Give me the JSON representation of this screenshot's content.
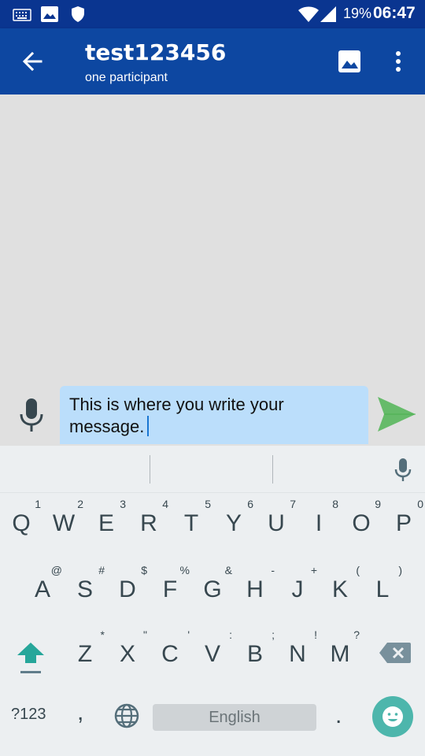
{
  "status_bar": {
    "battery_text": "19%",
    "time": "06:47",
    "icons": [
      "keyboard-icon",
      "image-icon",
      "shield-icon",
      "wifi-icon",
      "signal-icon",
      "battery-icon"
    ]
  },
  "app_bar": {
    "title": "test123456",
    "subtitle": "one participant",
    "icons": [
      "arrow-back-icon",
      "image-icon",
      "more-vert-icon"
    ]
  },
  "compose": {
    "text": "This is where you write your message.",
    "colors": {
      "field": "#bbdefb",
      "send": "#66bb6a",
      "caret": "#1976d2"
    }
  },
  "keyboard": {
    "row1": [
      {
        "key": "Q",
        "hint": "1"
      },
      {
        "key": "W",
        "hint": "2"
      },
      {
        "key": "E",
        "hint": "3"
      },
      {
        "key": "R",
        "hint": "4"
      },
      {
        "key": "T",
        "hint": "5"
      },
      {
        "key": "Y",
        "hint": "6"
      },
      {
        "key": "U",
        "hint": "7"
      },
      {
        "key": "I",
        "hint": "8"
      },
      {
        "key": "O",
        "hint": "9"
      },
      {
        "key": "P",
        "hint": "0"
      }
    ],
    "row2": [
      {
        "key": "A",
        "hint": "@"
      },
      {
        "key": "S",
        "hint": "#"
      },
      {
        "key": "D",
        "hint": "$"
      },
      {
        "key": "F",
        "hint": "%"
      },
      {
        "key": "G",
        "hint": "&"
      },
      {
        "key": "H",
        "hint": "-"
      },
      {
        "key": "J",
        "hint": "+"
      },
      {
        "key": "K",
        "hint": "("
      },
      {
        "key": "L",
        "hint": ")"
      }
    ],
    "row3": [
      {
        "key": "Z",
        "hint": "*"
      },
      {
        "key": "X",
        "hint": "\""
      },
      {
        "key": "C",
        "hint": "'"
      },
      {
        "key": "V",
        "hint": ":"
      },
      {
        "key": "B",
        "hint": ";"
      },
      {
        "key": "N",
        "hint": "!"
      },
      {
        "key": "M",
        "hint": "?"
      }
    ],
    "symbols_label": "?123",
    "comma": ",",
    "period": ".",
    "space_label": "English",
    "colors": {
      "emoji_bg": "#4db6ac",
      "shift": "#26a69a"
    }
  }
}
